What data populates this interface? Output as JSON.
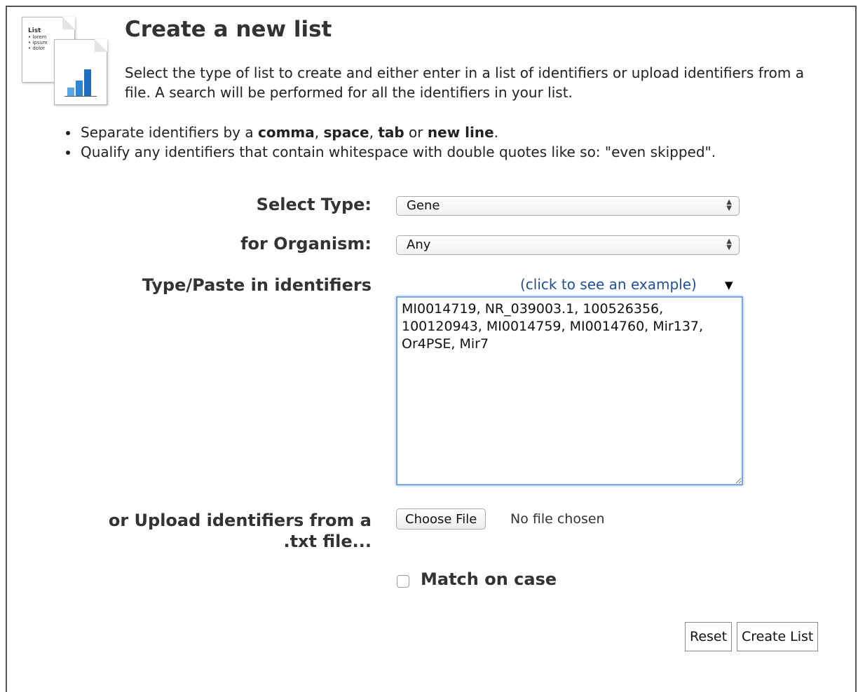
{
  "icon": {
    "name": "list-document-icon",
    "doc_title": "List",
    "doc_lines": [
      "• lorem",
      "• ipsum",
      "• dolor"
    ]
  },
  "header": {
    "title": "Create a new list",
    "description": "Select the type of list to create and either enter in a list of identifiers or upload identifiers from a file. A search will be performed for all the identifiers in your list."
  },
  "tips": {
    "separate_prefix": "Separate identifiers by a ",
    "comma": "comma",
    "sep1": ", ",
    "space": "space",
    "sep2": ", ",
    "tab": "tab",
    "or": " or ",
    "new_line": "new line",
    "end": ".",
    "qualify": "Qualify any identifiers that contain whitespace with double quotes like so: \"even skipped\"."
  },
  "form": {
    "type_label": "Select Type:",
    "type_value": "Gene",
    "organism_label": "for Organism:",
    "organism_value": "Any",
    "paste_label": "Type/Paste in identifiers",
    "example_link": "(click to see an example)",
    "example_arrow": "▼",
    "identifiers": "MI0014719, NR_039003.1, 100526356, 100120943, MI0014759, MI0014760, Mir137, Or4PSE, Mir7",
    "upload_label_line1": "or Upload identifiers from a",
    "upload_label_line2": ".txt file...",
    "choose_file": "Choose File",
    "file_status": "No file chosen",
    "match_case": "Match on case",
    "reset": "Reset",
    "create": "Create List"
  }
}
